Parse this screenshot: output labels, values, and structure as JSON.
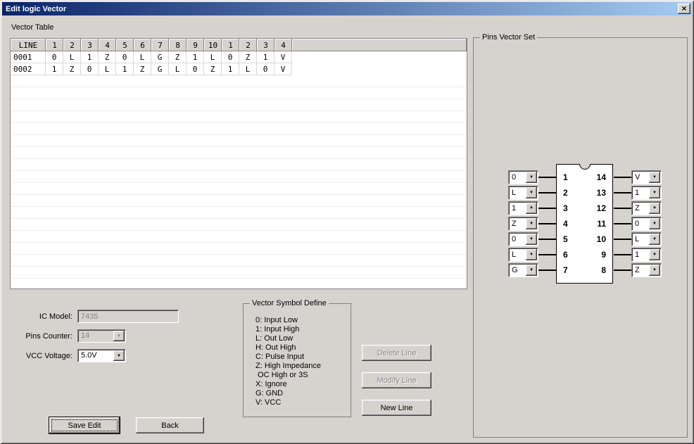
{
  "window": {
    "title": "Edit logic Vector",
    "close_icon": "×"
  },
  "vector_table": {
    "group_label": "Vector Table",
    "headers": [
      "LINE",
      "1",
      "2",
      "3",
      "4",
      "5",
      "6",
      "7",
      "8",
      "9",
      "10",
      "1",
      "2",
      "3",
      "4"
    ],
    "rows": [
      {
        "line": "0001",
        "values": [
          "0",
          "L",
          "1",
          "Z",
          "0",
          "L",
          "G",
          "Z",
          "1",
          "L",
          "0",
          "Z",
          "1",
          "V"
        ]
      },
      {
        "line": "0002",
        "values": [
          "1",
          "Z",
          "0",
          "L",
          "1",
          "Z",
          "G",
          "L",
          "0",
          "Z",
          "1",
          "L",
          "0",
          "V"
        ]
      }
    ]
  },
  "form": {
    "ic_model": {
      "label": "IC Model:",
      "value": "7435"
    },
    "pins_counter": {
      "label": "Pins Counter:",
      "value": "14"
    },
    "vcc_voltage": {
      "label": "VCC Voltage:",
      "value": "5.0V"
    }
  },
  "symbol_define": {
    "group_label": "Vector Symbol Define",
    "lines": [
      "0: Input Low",
      "1: Input High",
      "L: Out Low",
      "H: Out High",
      "C: Pulse Input",
      "Z: High Impedance",
      " OC High or 3S",
      "X: Ignore",
      "G: GND",
      "V: VCC"
    ]
  },
  "line_buttons": {
    "delete": "Delete Line",
    "modify": "Modify Line",
    "new": "New Line"
  },
  "footer_buttons": {
    "save": "Save Edit",
    "back": "Back"
  },
  "pins_vector_set": {
    "group_label": "Pins Vector Set",
    "left_pins": [
      {
        "pin": "1",
        "value": "0"
      },
      {
        "pin": "2",
        "value": "L"
      },
      {
        "pin": "3",
        "value": "1"
      },
      {
        "pin": "4",
        "value": "Z"
      },
      {
        "pin": "5",
        "value": "0"
      },
      {
        "pin": "6",
        "value": "L"
      },
      {
        "pin": "7",
        "value": "G"
      }
    ],
    "right_pins": [
      {
        "pin": "14",
        "value": "V"
      },
      {
        "pin": "13",
        "value": "1"
      },
      {
        "pin": "12",
        "value": "Z"
      },
      {
        "pin": "11",
        "value": "0"
      },
      {
        "pin": "10",
        "value": "L"
      },
      {
        "pin": "9",
        "value": "1"
      },
      {
        "pin": "8",
        "value": "Z"
      }
    ]
  },
  "colors": {
    "titlebar_start": "#0a246a",
    "titlebar_end": "#a6caf0",
    "window_bg": "#d6d3ce",
    "disabled_text": "#848484"
  }
}
